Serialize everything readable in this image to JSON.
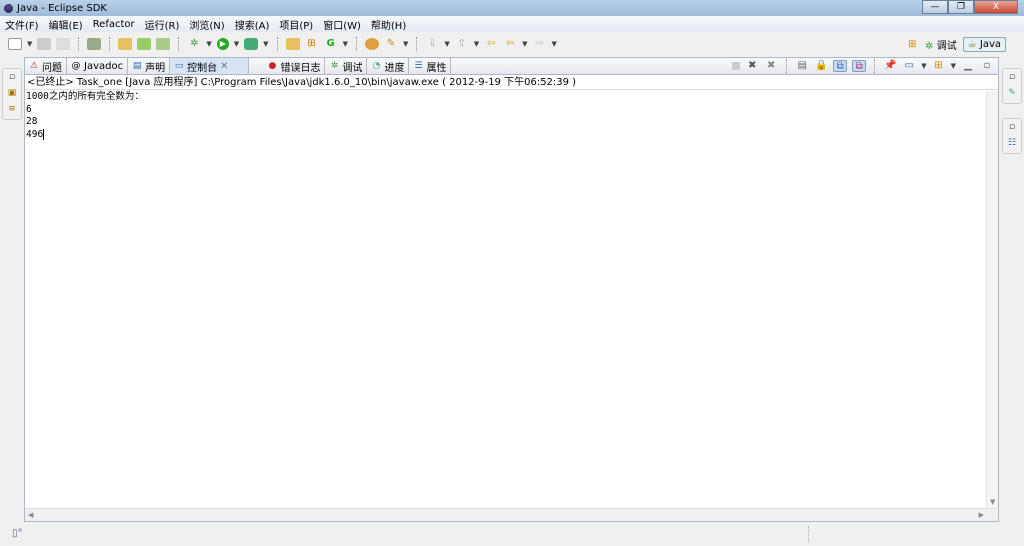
{
  "window": {
    "title": "Java  - Eclipse SDK",
    "minimize": "—",
    "maximize": "❐",
    "close": "X"
  },
  "menu": [
    "文件(F)",
    "编辑(E)",
    "Refactor",
    "运行(R)",
    "浏览(N)",
    "搜索(A)",
    "项目(P)",
    "窗口(W)",
    "帮助(H)"
  ],
  "perspectives": {
    "debug": "调试",
    "java": "Java"
  },
  "tabs": [
    {
      "label": "问题",
      "icon": "problems-icon"
    },
    {
      "label": "Javadoc",
      "icon": "@"
    },
    {
      "label": "声明",
      "icon": "declaration-icon"
    },
    {
      "label": "控制台",
      "icon": "console-icon",
      "active": true,
      "close": "✕"
    },
    {
      "label": "错误日志",
      "icon": "error-log-icon"
    },
    {
      "label": "调试",
      "icon": "debug-icon"
    },
    {
      "label": "进度",
      "icon": "progress-icon"
    },
    {
      "label": "属性",
      "icon": "properties-icon"
    }
  ],
  "console": {
    "header": "<已终止> Task_one [Java 应用程序] C:\\Program Files\\Java\\jdk1.6.0_10\\bin\\javaw.exe ( 2012-9-19 下午06:52:39 )",
    "lines": [
      "1000之内的所有完全数为：",
      "6",
      "28",
      "496"
    ]
  }
}
